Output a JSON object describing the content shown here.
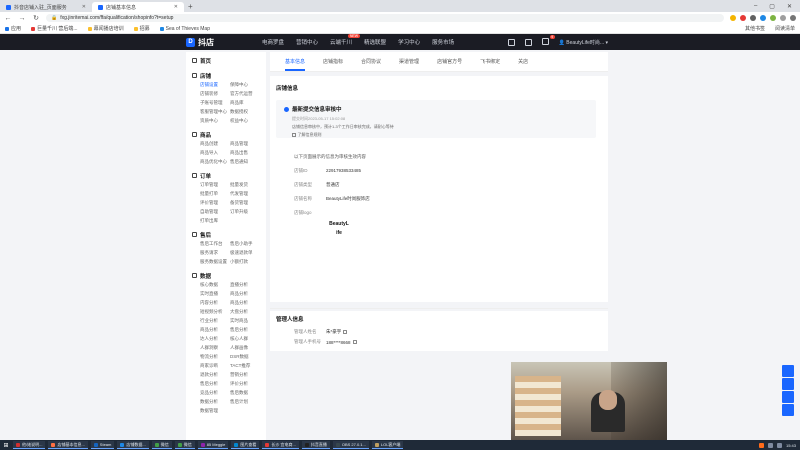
{
  "browser": {
    "tabs": [
      {
        "title": "抖音店铺入驻_页面服务",
        "active": false,
        "color": "#1966ff"
      },
      {
        "title": "店铺基本信息",
        "active": true,
        "color": "#1966ff"
      }
    ],
    "url": "fxg.jinritemai.com/ffa/qualification/shopinfo?t=setup",
    "bookmarks": [
      "应用",
      "巨量千川 营后端...",
      "幕闻播店培训",
      "招募",
      "Sea of Thieves Map"
    ],
    "bookmarks_right": [
      "其他书签",
      "阅读清单"
    ]
  },
  "app_header": {
    "logo_text": "抖店",
    "nav": [
      {
        "label": "电商罗盘"
      },
      {
        "label": "营销中心"
      },
      {
        "label": "云端千川",
        "badge": "NEW"
      },
      {
        "label": "精选联盟"
      },
      {
        "label": "学习中心"
      },
      {
        "label": "服务市场"
      }
    ],
    "msg_badge": "9",
    "user": "BeautyLife时尚..."
  },
  "sidebar": {
    "groups": [
      {
        "title": "首页",
        "items": []
      },
      {
        "title": "店铺",
        "items": [
          "店铺设置",
          "保障中心",
          "店铺装修",
          "官方代运营",
          "子账号管理",
          "商品库",
          "客服管理中心",
          "数据授权",
          "资质中心",
          "权益中心"
        ],
        "active_index": 0
      },
      {
        "title": "商品",
        "items": [
          "商品创建",
          "商品管理",
          "商品导入",
          "商品出售",
          "商品优化中心",
          "售后通知"
        ]
      },
      {
        "title": "订单",
        "items": [
          "订单管理",
          "批量发货",
          "批量打单",
          "代发管理",
          "评价管理",
          "备货管理",
          "自助管理",
          "订单升级",
          "打单出库"
        ]
      },
      {
        "title": "售后",
        "items": [
          "售后工作台",
          "售后小助手",
          "服务请求",
          "极速退款单",
          "服务数据设置",
          "小额打款"
        ]
      },
      {
        "title": "数据",
        "items": [
          "核心数据",
          "直播分析",
          "实时直播",
          "商品分析",
          "内容分析",
          "商品分析",
          "短视频分析",
          "大盘分析",
          "行业分析",
          "实时商品",
          "商品分析",
          "售后分析",
          "达人分析",
          "核心人群",
          "人群洞察",
          "人群画像",
          "物流分析",
          "DSR数据",
          "商家诊断",
          "TACT推荐",
          "退款分析",
          "营销分析",
          "售后分析",
          "评价分析",
          "竞品分析",
          "售后数据",
          "数据分析",
          "售后计划",
          "数据管理"
        ]
      }
    ]
  },
  "main": {
    "tabs": [
      "基本信息",
      "店铺指标",
      "合同协议",
      "渠道管理",
      "店铺官方号",
      "飞书绑定",
      "关店"
    ],
    "active_tab": 0,
    "section_basic": "店铺信息",
    "review": {
      "title": "最新提交信息审核中",
      "time": "提交时间2023-05-17 15:02:08",
      "desc": "店铺信息审核中，预计1-3个工作日审核完成，请耐心等待",
      "link": "了解信息规则"
    },
    "note": "以下页面展示的信息为审核生效内容",
    "fields": [
      {
        "key": "店铺ID",
        "value": "22917938533485"
      },
      {
        "key": "店铺类型",
        "value": "普通店"
      },
      {
        "key": "店铺名称",
        "value": "BeautyLife时尚服饰店"
      },
      {
        "key": "店铺logo",
        "value": "BeautyLife"
      }
    ],
    "logo_line1": "BeautyL",
    "logo_line2": "ife",
    "section_manager": "管理人信息",
    "manager": [
      {
        "key": "管理人姓名",
        "value": "朱*豪宇"
      },
      {
        "key": "管理人手机号",
        "value": "188****8668"
      }
    ]
  },
  "taskbar": {
    "items": [
      "他/她说明...",
      "店铺基本信息...",
      "Steam",
      "店铺数据...",
      "微信",
      "微信",
      "85 Meggie",
      "图片查看",
      "长沙 宜电商...",
      "抖音直播",
      "OBS 27.0.1...",
      "LOL客户端"
    ],
    "time": "15:43"
  }
}
